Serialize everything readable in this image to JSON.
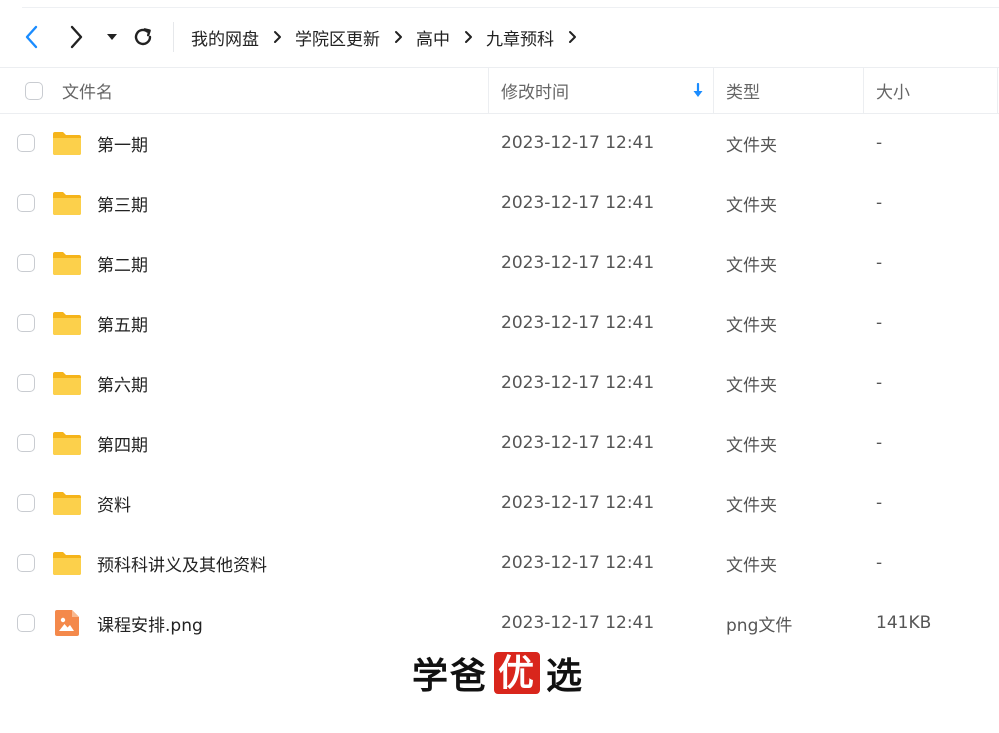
{
  "nav": {
    "back_icon": "chevron-left-icon",
    "forward_icon": "chevron-right-icon",
    "dropdown_icon": "caret-down-icon",
    "refresh_icon": "refresh-icon"
  },
  "breadcrumb": [
    "我的网盘",
    "学院区更新",
    "高中",
    "九章预科"
  ],
  "columns": {
    "name": "文件名",
    "modified": "修改时间",
    "type": "类型",
    "size": "大小"
  },
  "sort": {
    "column": "modified",
    "direction": "descending",
    "icon": "sort-down-arrow-icon",
    "color": "#1a8cff"
  },
  "files": [
    {
      "name": "第一期",
      "modified": "2023-12-17 12:41",
      "type": "文件夹",
      "size": "-",
      "icon": "folder-icon"
    },
    {
      "name": "第三期",
      "modified": "2023-12-17 12:41",
      "type": "文件夹",
      "size": "-",
      "icon": "folder-icon"
    },
    {
      "name": "第二期",
      "modified": "2023-12-17 12:41",
      "type": "文件夹",
      "size": "-",
      "icon": "folder-icon"
    },
    {
      "name": "第五期",
      "modified": "2023-12-17 12:41",
      "type": "文件夹",
      "size": "-",
      "icon": "folder-icon"
    },
    {
      "name": "第六期",
      "modified": "2023-12-17 12:41",
      "type": "文件夹",
      "size": "-",
      "icon": "folder-icon"
    },
    {
      "name": "第四期",
      "modified": "2023-12-17 12:41",
      "type": "文件夹",
      "size": "-",
      "icon": "folder-icon"
    },
    {
      "name": "资料",
      "modified": "2023-12-17 12:41",
      "type": "文件夹",
      "size": "-",
      "icon": "folder-icon"
    },
    {
      "name": "预科科讲义及其他资料",
      "modified": "2023-12-17 12:41",
      "type": "文件夹",
      "size": "-",
      "icon": "folder-icon"
    },
    {
      "name": "课程安排.png",
      "modified": "2023-12-17 12:41",
      "type": "png文件",
      "size": "141KB",
      "icon": "image-file-icon"
    }
  ],
  "watermark": {
    "text_a": "学爸",
    "stamp": "优",
    "text_b": "选"
  },
  "colors": {
    "accent": "#1a8cff",
    "folder": "#fbc02d",
    "image_file": "#f4894b",
    "stamp": "#d9261c"
  }
}
